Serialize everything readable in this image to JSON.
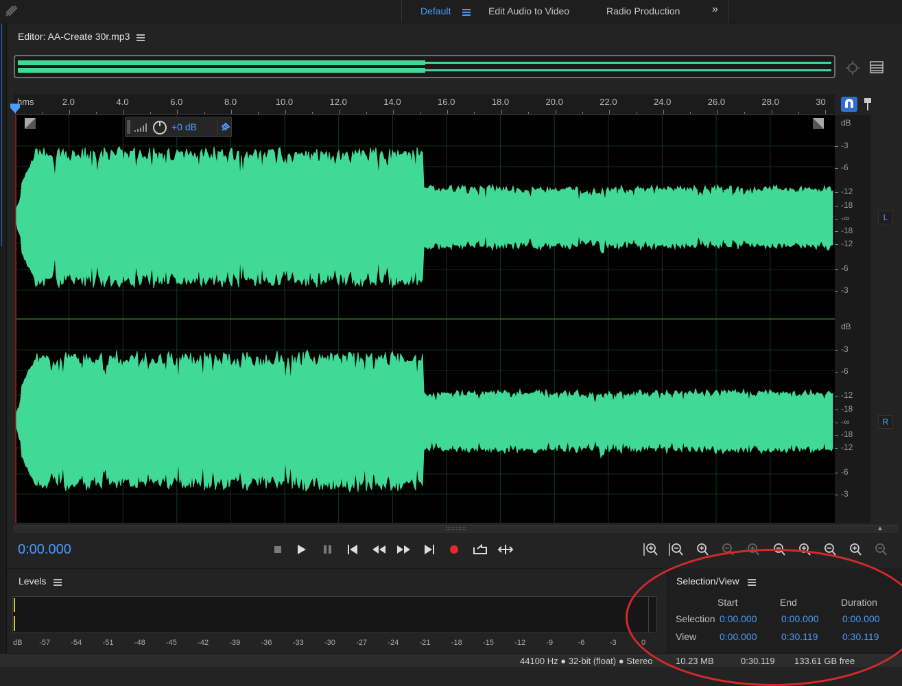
{
  "workspaces": {
    "items": [
      "Default",
      "Edit Audio to Video",
      "Radio Production"
    ],
    "more_icon": "chevron-double-right-icon"
  },
  "editor": {
    "title": "Editor: AA-Create 30r.mp3",
    "ruler_unit": "hms",
    "ruler_labels": [
      "2.0",
      "4.0",
      "6.0",
      "8.0",
      "10.0",
      "12.0",
      "14.0",
      "16.0",
      "18.0",
      "20.0",
      "22.0",
      "24.0",
      "26.0",
      "28.0",
      "30"
    ],
    "hud": {
      "volume": "+0 dB"
    },
    "db_labels": [
      "dB",
      "-3",
      "-6",
      "-12",
      "-18",
      "-∞",
      "-18",
      "-12",
      "-6",
      "-3"
    ],
    "channels": [
      "L",
      "R"
    ],
    "waveform_color": "#41d996",
    "playhead_color": "#4a9cff",
    "duration_seconds": 30.119
  },
  "transport": {
    "timecode": "0:00.000",
    "buttons": [
      "stop-icon",
      "play-icon",
      "pause-icon",
      "skip-to-start-icon",
      "rewind-icon",
      "fast-forward-icon",
      "skip-to-end-icon",
      "record-icon",
      "loop-icon",
      "skip-selection-icon"
    ],
    "zoom_buttons": [
      "zoom-in-amplitude-icon",
      "zoom-out-amplitude-icon",
      "zoom-in-time-icon",
      "zoom-out-time-icon",
      "zoom-selection-icon",
      "zoom-in-point-icon",
      "zoom-out-full-icon",
      "zoom-fit-icon",
      "zoom-reset-icon",
      "zoom-tracks-icon"
    ]
  },
  "levels": {
    "title": "Levels",
    "scale": [
      "dB",
      "-57",
      "-54",
      "-51",
      "-48",
      "-45",
      "-42",
      "-39",
      "-36",
      "-33",
      "-30",
      "-27",
      "-24",
      "-21",
      "-18",
      "-15",
      "-12",
      "-9",
      "-6",
      "-3",
      "0"
    ]
  },
  "selection_view": {
    "title": "Selection/View",
    "columns": [
      "Start",
      "End",
      "Duration"
    ],
    "rows": [
      {
        "label": "Selection",
        "start": "0:00.000",
        "end": "0:00.000",
        "duration": "0:00.000"
      },
      {
        "label": "View",
        "start": "0:00.000",
        "end": "0:30.119",
        "duration": "0:30.119"
      }
    ]
  },
  "status": {
    "format": "44100 Hz ● 32-bit (float) ● Stereo",
    "size": "10.23 MB",
    "duration": "0:30.119",
    "free": "133.61 GB free"
  }
}
